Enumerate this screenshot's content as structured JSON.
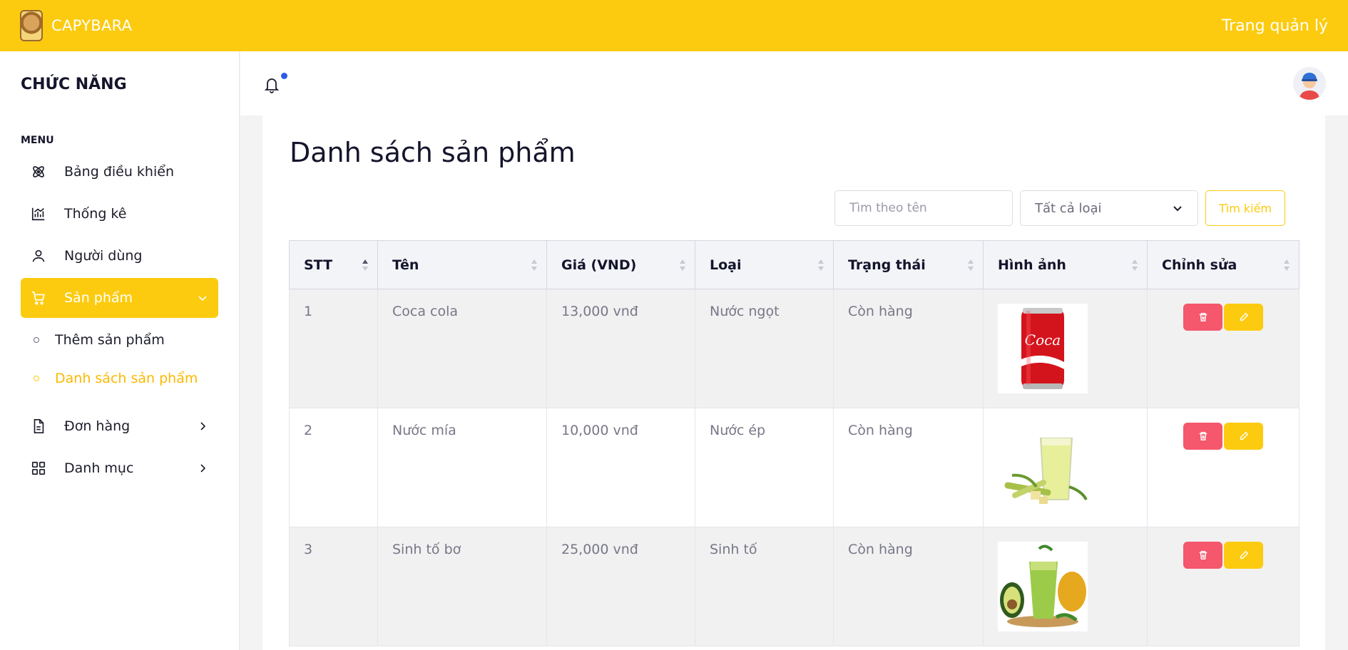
{
  "topbar": {
    "brand": "CAPYBARA",
    "title": "Trang quản lý"
  },
  "sidebar": {
    "heading": "CHỨC NĂNG",
    "menu_label": "MENU",
    "items": [
      {
        "label": "Bảng điều khiển",
        "icon": "dashboard-icon"
      },
      {
        "label": "Thống kê",
        "icon": "chart-icon"
      },
      {
        "label": "Người dùng",
        "icon": "user-icon"
      },
      {
        "label": "Sản phẩm",
        "icon": "cart-icon",
        "active": true
      },
      {
        "label": "Đơn hàng",
        "icon": "document-icon"
      },
      {
        "label": "Danh mục",
        "icon": "grid-icon"
      }
    ],
    "submenu": [
      {
        "label": "Thêm sản phẩm"
      },
      {
        "label": "Danh sách sản phẩm",
        "active": true
      }
    ]
  },
  "main": {
    "title": "Danh sách sản phẩm",
    "search": {
      "placeholder": "Tìm theo tên",
      "value": ""
    },
    "category_select": {
      "selected": "Tất cả loại"
    },
    "search_button": "Tìm kiếm",
    "table": {
      "columns": [
        "STT",
        "Tên",
        "Giá (VND)",
        "Loại",
        "Trạng thái",
        "Hình ảnh",
        "Chỉnh sửa"
      ],
      "rows": [
        {
          "stt": "1",
          "name": "Coca cola",
          "price": "13,000 vnđ",
          "type": "Nước ngọt",
          "status": "Còn hàng",
          "image": "coca-cola-can"
        },
        {
          "stt": "2",
          "name": "Nước mía",
          "price": "10,000 vnđ",
          "type": "Nước ép",
          "status": "Còn hàng",
          "image": "sugarcane-juice"
        },
        {
          "stt": "3",
          "name": "Sinh tố bơ",
          "price": "25,000 vnđ",
          "type": "Sinh tố",
          "status": "Còn hàng",
          "image": "avocado-smoothie"
        }
      ]
    }
  },
  "colors": {
    "accent": "#fccb0f",
    "danger": "#f5576c",
    "notification": "#2d5be3"
  }
}
